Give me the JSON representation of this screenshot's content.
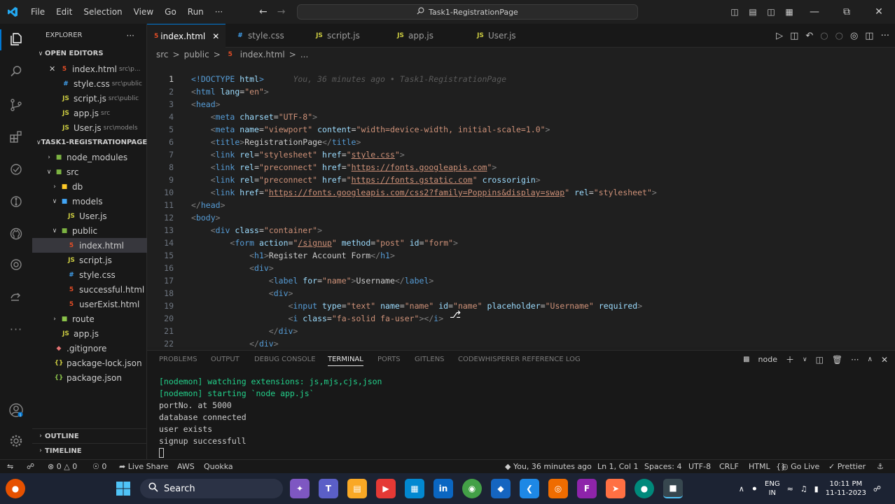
{
  "titlebar": {
    "menu": [
      "File",
      "Edit",
      "Selection",
      "View",
      "Go",
      "Run",
      "···"
    ],
    "search_text": "Task1-RegistrationPage"
  },
  "sidebar": {
    "title": "EXPLORER",
    "open_editors_label": "OPEN EDITORS",
    "open_editors": [
      {
        "name": "index.html",
        "path": "src\\p...",
        "type": "html"
      },
      {
        "name": "style.css",
        "path": "src\\public",
        "type": "css"
      },
      {
        "name": "script.js",
        "path": "src\\public",
        "type": "js"
      },
      {
        "name": "app.js",
        "path": "src",
        "type": "js"
      },
      {
        "name": "User.js",
        "path": "src\\models",
        "type": "js"
      }
    ],
    "project_label": "TASK1-REGISTRATIONPAGE",
    "tree": {
      "node_modules": "node_modules",
      "src": "src",
      "db": "db",
      "models": "models",
      "user_js": "User.js",
      "public": "public",
      "index_html": "index.html",
      "script_js": "script.js",
      "style_css": "style.css",
      "successful_html": "successful.html",
      "userexist_html": "userExist.html",
      "route": "route",
      "app_js": "app.js",
      "gitignore": ".gitignore",
      "package_lock": "package-lock.json",
      "package_json": "package.json"
    },
    "outline_label": "OUTLINE",
    "timeline_label": "TIMELINE"
  },
  "tabs": [
    {
      "label": "index.html",
      "type": "html",
      "active": true
    },
    {
      "label": "style.css",
      "type": "css"
    },
    {
      "label": "script.js",
      "type": "js"
    },
    {
      "label": "app.js",
      "type": "js"
    },
    {
      "label": "User.js",
      "type": "js"
    }
  ],
  "breadcrumb": {
    "parts": [
      "src",
      "public",
      "index.html",
      "..."
    ],
    "sep": ">"
  },
  "editor": {
    "blame": "You, 36 minutes ago • Task1-RegistrationPage",
    "line_numbers": [
      "1",
      "2",
      "3",
      "4",
      "5",
      "6",
      "7",
      "8",
      "9",
      "10",
      "11",
      "12",
      "13",
      "14",
      "15",
      "16",
      "17",
      "18",
      "19",
      "20",
      "21",
      "22"
    ]
  },
  "panel": {
    "tabs": [
      "PROBLEMS",
      "OUTPUT",
      "DEBUG CONSOLE",
      "TERMINAL",
      "PORTS",
      "GITLENS",
      "CODEWHISPERER REFERENCE LOG"
    ],
    "active_tab": "TERMINAL",
    "shell": "node",
    "terminal_lines": [
      "[nodemon] watching extensions: js,mjs,cjs,json",
      "[nodemon] starting `node app.js`",
      "portNo. at 5000",
      "database connected",
      "user exists",
      "signup successfull"
    ]
  },
  "statusbar": {
    "errors": "0",
    "warnings": "0",
    "ports": "0",
    "live_share": "Live Share",
    "aws": "AWS",
    "quokka": "Quokka",
    "blame": "You, 36 minutes ago",
    "position": "Ln 1, Col 1",
    "spaces": "Spaces: 4",
    "encoding": "UTF-8",
    "eol": "CRLF",
    "language": "HTML",
    "go_live": "Go Live",
    "prettier": "Prettier"
  },
  "taskbar": {
    "search_label": "Search",
    "lang_top": "ENG",
    "lang_bottom": "IN",
    "time": "10:11 PM",
    "date": "11-11-2023"
  },
  "colors": {
    "accent": "#0078d4",
    "editor_bg": "#1f1f1f",
    "sidebar_bg": "#181818",
    "taskbar_bg": "#1c2333"
  }
}
